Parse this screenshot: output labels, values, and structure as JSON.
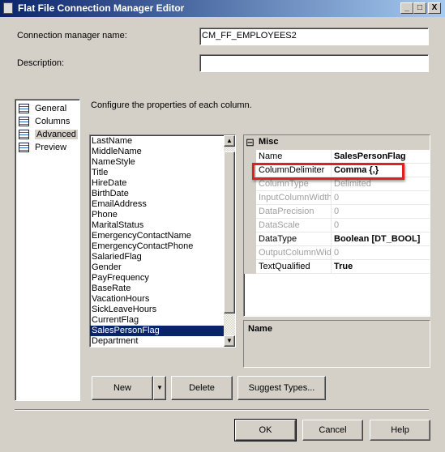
{
  "window": {
    "title": "Flat File Connection Manager Editor",
    "min": "_",
    "max": "□",
    "close": "X"
  },
  "form": {
    "name_label": "Connection manager name:",
    "name_value": "CM_FF_EMPLOYEES2",
    "desc_label": "Description:",
    "desc_value": ""
  },
  "nav": {
    "items": [
      {
        "label": "General"
      },
      {
        "label": "Columns"
      },
      {
        "label": "Advanced",
        "selected": true
      },
      {
        "label": "Preview"
      }
    ]
  },
  "main": {
    "instruction": "Configure the properties of each column.",
    "columns": [
      "LastName",
      "MiddleName",
      "NameStyle",
      "Title",
      "HireDate",
      "BirthDate",
      "EmailAddress",
      "Phone",
      "MaritalStatus",
      "EmergencyContactName",
      "EmergencyContactPhone",
      "SalariedFlag",
      "Gender",
      "PayFrequency",
      "BaseRate",
      "VacationHours",
      "SickLeaveHours",
      "CurrentFlag",
      "SalesPersonFlag",
      "Department"
    ],
    "selected_column": "SalesPersonFlag",
    "properties": {
      "category": "Misc",
      "collapse": "⊟",
      "rows": [
        {
          "key": "Name",
          "value": "SalesPersonFlag",
          "enabled": true
        },
        {
          "key": "ColumnDelimiter",
          "value": "Comma {,}",
          "enabled": true
        },
        {
          "key": "ColumnType",
          "value": "Delimited",
          "enabled": false
        },
        {
          "key": "InputColumnWidth",
          "value": "0",
          "enabled": false
        },
        {
          "key": "DataPrecision",
          "value": "0",
          "enabled": false
        },
        {
          "key": "DataScale",
          "value": "0",
          "enabled": false
        },
        {
          "key": "DataType",
          "value": "Boolean [DT_BOOL]",
          "enabled": true
        },
        {
          "key": "OutputColumnWidth",
          "value": "0",
          "enabled": false
        },
        {
          "key": "TextQualified",
          "value": "True",
          "enabled": true
        }
      ]
    },
    "description_title": "Name",
    "highlight_color": "#e02020"
  },
  "buttons": {
    "new": "New",
    "new_dropdown": "▼",
    "delete": "Delete",
    "suggest": "Suggest Types...",
    "ok": "OK",
    "cancel": "Cancel",
    "help": "Help"
  }
}
